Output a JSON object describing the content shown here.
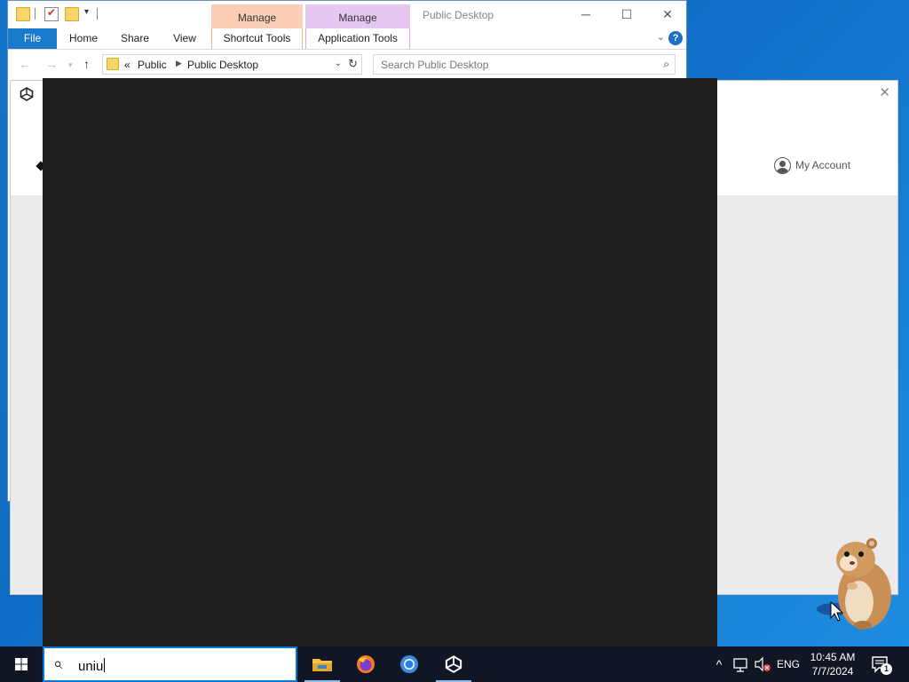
{
  "explorer": {
    "title": "Public Desktop",
    "context_tab_1": "Manage",
    "context_tab_2": "Manage",
    "tabs": {
      "file": "File",
      "home": "Home",
      "share": "Share",
      "view": "View",
      "shortcut_tools": "Shortcut Tools",
      "application_tools": "Application Tools"
    },
    "breadcrumb": {
      "prefix": "«",
      "items": [
        "Public",
        "Public Desktop"
      ]
    },
    "search_placeholder": "Search Public Desktop",
    "window_buttons": {
      "minimize": "─",
      "maximize": "☐",
      "close": "✕"
    }
  },
  "unity_hub": {
    "account_label": "My Account",
    "close_glyph": "✕"
  },
  "taskbar": {
    "search_query": "uniu",
    "apps": [
      "file-explorer",
      "firefox",
      "chrome",
      "unity-hub"
    ],
    "language": "ENG",
    "time": "10:45 AM",
    "date": "7/7/2024",
    "notification_count": "1"
  },
  "colors": {
    "desktop": "#1374c9",
    "file_tab": "#1979ca",
    "shortcut_tools_ctx": "#fbd0b6",
    "application_tools_ctx": "#e6c8f3",
    "dark_window": "#1e1e1e",
    "taskbar": "#101624"
  }
}
